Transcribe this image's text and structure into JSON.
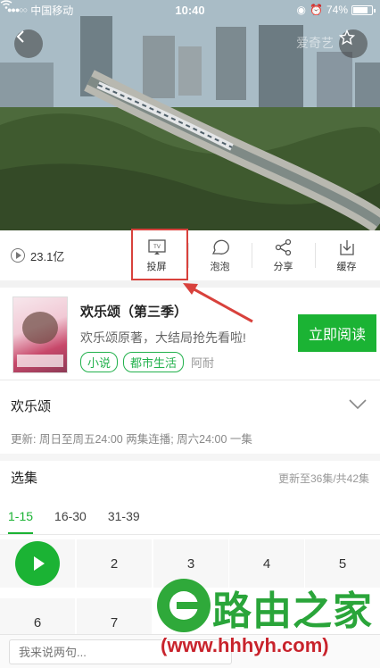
{
  "status_bar": {
    "carrier": "中国移动",
    "time": "10:40",
    "battery": "74%"
  },
  "video": {
    "watermark": "爱奇艺"
  },
  "action_bar": {
    "play_count": "23.1亿",
    "actions": [
      {
        "label": "投屏",
        "icon": "tv-icon"
      },
      {
        "label": "泡泡",
        "icon": "bubble-icon"
      },
      {
        "label": "分享",
        "icon": "share-icon"
      },
      {
        "label": "缓存",
        "icon": "download-icon"
      }
    ]
  },
  "promo": {
    "title": "欢乐颂（第三季）",
    "desc": "欢乐颂原著，大结局抢先看啦!",
    "tags": [
      "小说",
      "都市生活"
    ],
    "author": "阿耐",
    "button": "立即阅读"
  },
  "show": {
    "title": "欢乐颂",
    "schedule": "更新: 周日至周五24:00 两集连播; 周六24:00 一集"
  },
  "episodes": {
    "title": "选集",
    "status": "更新至36集/共42集",
    "ranges": [
      "1-15",
      "16-30",
      "31-39"
    ],
    "active_range": "1-15",
    "items": [
      "1",
      "2",
      "3",
      "4",
      "5",
      "6",
      "7"
    ]
  },
  "comment": {
    "placeholder": "我来说两句..."
  },
  "watermark": {
    "text": "路由之家",
    "url": "(www.hhhyh.com)"
  },
  "colors": {
    "accent_green": "#1bb334",
    "highlight_red": "#d8413c"
  }
}
